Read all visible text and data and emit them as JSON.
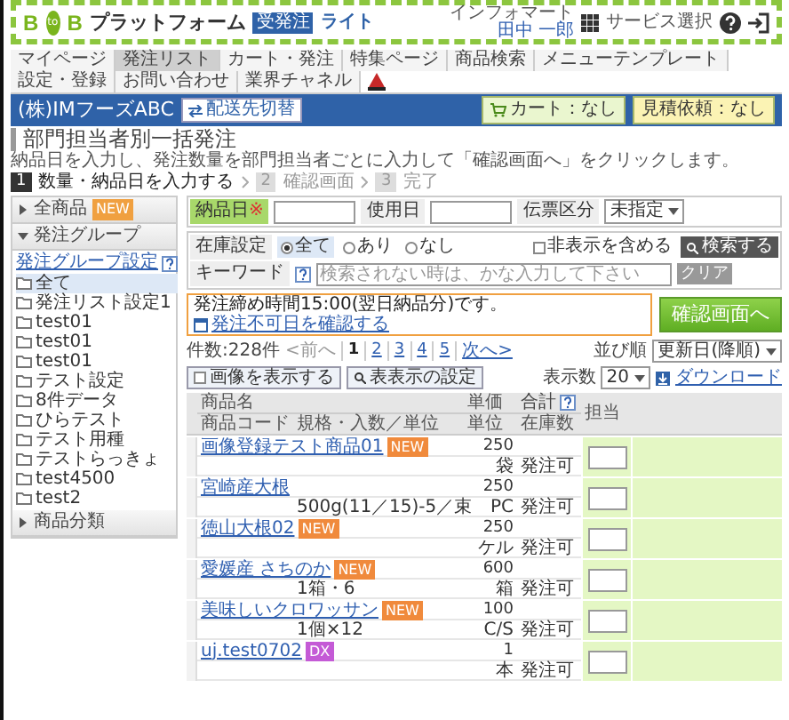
{
  "header": {
    "logo_b1": "B",
    "logo_to": "to",
    "logo_b2": "B",
    "brand": "プラットフォーム",
    "badge": "受発注",
    "edition": "ライト",
    "user_company": "インフォマート",
    "user_name": "田中 一郎",
    "service_label": "サービス選択"
  },
  "tabs": [
    {
      "label": "マイページ",
      "selected": false
    },
    {
      "label": "発注リスト",
      "selected": true
    },
    {
      "label": "カート・発注",
      "selected": false
    },
    {
      "label": "特集ページ",
      "selected": false
    },
    {
      "label": "商品検索",
      "selected": false
    },
    {
      "label": "メニューテンプレート",
      "selected": false
    },
    {
      "label": "設定・登録",
      "selected": false
    },
    {
      "label": "お問い合わせ",
      "selected": false
    },
    {
      "label": "業界チャネル",
      "selected": false
    }
  ],
  "account_bar": {
    "company": "(株)IMフーズABC",
    "switch_button": "配送先切替",
    "cart": "カート：なし",
    "quote": "見積依頼：なし"
  },
  "page": {
    "title": "部門担当者別一括発注",
    "description": "納品日を入力し、発注数量を部門担当者ごとに入力して「確認画面へ」をクリックします。"
  },
  "steps": [
    {
      "number": "1",
      "label": "数量・納品日を入力する",
      "selected": true
    },
    {
      "number": "2",
      "label": "確認画面",
      "selected": false
    },
    {
      "number": "3",
      "label": "完了",
      "selected": false
    }
  ],
  "sidebar": {
    "all_products": {
      "label": "全商品",
      "badge": "NEW",
      "expanded": false
    },
    "order_group": {
      "label": "発注グループ",
      "expanded": true,
      "settings_link": "発注グループ設定",
      "items": [
        {
          "label": "全て",
          "selected": true
        },
        {
          "label": "発注リスト設定1",
          "selected": false
        },
        {
          "label": "test01",
          "selected": false
        },
        {
          "label": "test01",
          "selected": false
        },
        {
          "label": "test01",
          "selected": false
        },
        {
          "label": "テスト設定",
          "selected": false
        },
        {
          "label": "8件データ",
          "selected": false
        },
        {
          "label": "ひらテスト",
          "selected": false
        },
        {
          "label": "テスト用種",
          "selected": false
        },
        {
          "label": "テストらっきょ",
          "selected": false
        },
        {
          "label": "test4500",
          "selected": false
        },
        {
          "label": "test2",
          "selected": false
        }
      ]
    },
    "category": {
      "label": "商品分類",
      "expanded": false
    }
  },
  "filters": {
    "delivery_date": {
      "label": "納品日",
      "required_mark": "※"
    },
    "use_date": {
      "label": "使用日"
    },
    "slip_type": {
      "label": "伝票区分",
      "value": "未指定"
    },
    "stock": {
      "label": "在庫設定",
      "options": [
        {
          "label": "全て",
          "selected": true
        },
        {
          "label": "あり",
          "selected": false
        },
        {
          "label": "なし",
          "selected": false
        }
      ]
    },
    "keyword": {
      "label": "キーワード",
      "placeholder": "検索されない時は、かな入力して下さい",
      "clear_button": "クリア",
      "include_hidden": {
        "label": "非表示を含める",
        "checked": false
      },
      "search_button": "検索する"
    }
  },
  "notice": {
    "text": "発注締め時間15:00(翌日納品分)です。",
    "link": "発注不可日を確認する"
  },
  "confirm_button": "確認画面へ",
  "list": {
    "count": "件数:228件",
    "prev": "<前へ",
    "pages": [
      {
        "label": "1",
        "selected": true
      },
      {
        "label": "2",
        "selected": false
      },
      {
        "label": "3",
        "selected": false
      },
      {
        "label": "4",
        "selected": false
      },
      {
        "label": "5",
        "selected": false
      }
    ],
    "next": "次へ>",
    "sort_label": "並び順",
    "sort_value": "更新日(降順)",
    "per_page_label": "表示数",
    "per_page_value": "20",
    "show_images": {
      "label": "画像を表示する",
      "checked": false
    },
    "table_settings": "表表示の設定",
    "download": "ダウンロード"
  },
  "table": {
    "columns": {
      "name": "商品名",
      "code": "商品コード",
      "spec": "規格・入数／単位",
      "price": "単価",
      "unit": "単位",
      "total": "合計",
      "stock": "在庫数",
      "person": "担当"
    },
    "rows": [
      {
        "name": "画像登録テスト商品01",
        "badge": {
          "text": "NEW",
          "color": "#f08a3c"
        },
        "spec": "",
        "price": "250",
        "unit": "袋",
        "stock": "発注可"
      },
      {
        "name": "宮崎産大根",
        "spec": "500g(11／15)-5／束",
        "price": "250",
        "unit": "PC",
        "stock": "発注可"
      },
      {
        "name": "徳山大根02",
        "badge": {
          "text": "NEW",
          "color": "#f08a3c"
        },
        "spec": "",
        "price": "250",
        "unit": "ケル",
        "stock": "発注可"
      },
      {
        "name": "愛媛産 さちのか",
        "badge": {
          "text": "NEW",
          "color": "#f08a3c"
        },
        "spec": "1箱・6",
        "price": "600",
        "unit": "箱",
        "stock": "発注可"
      },
      {
        "name": "美味しいクロワッサン",
        "badge": {
          "text": "NEW",
          "color": "#f08a3c"
        },
        "spec": "1個×12",
        "price": "100",
        "unit": "C/S",
        "stock": "発注可"
      },
      {
        "name": "uj.test0702",
        "badge": {
          "text": "DX",
          "color": "#c45ad6"
        },
        "spec": "",
        "price": "1",
        "unit": "本",
        "stock": "発注可"
      }
    ]
  }
}
